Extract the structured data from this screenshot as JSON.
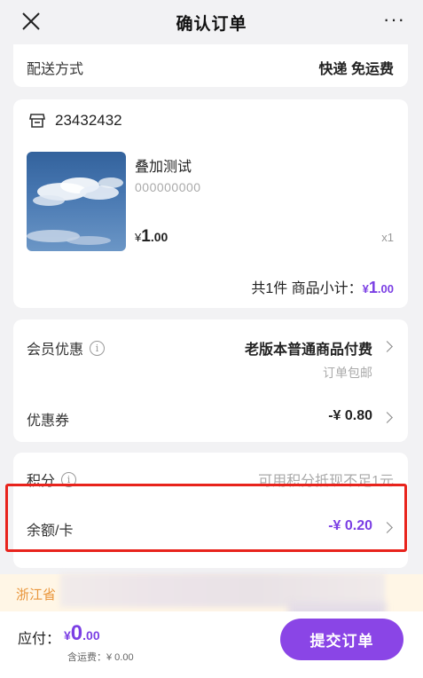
{
  "header": {
    "title": "确认订单",
    "more": "···"
  },
  "delivery": {
    "label": "配送方式",
    "value": "快递 免运费"
  },
  "shop": {
    "name": "23432432"
  },
  "product": {
    "title": "叠加测试",
    "sku": "000000000",
    "price_symbol": "¥",
    "price_int": "1",
    "price_dec": ".00",
    "qty": "x1"
  },
  "subtotal": {
    "prefix": "共1件  商品小计：",
    "symbol": "¥",
    "int": "1",
    "dec": ".00"
  },
  "member": {
    "label": "会员优惠",
    "info": "i",
    "value": "老版本普通商品付费",
    "sub": "订单包邮"
  },
  "coupon": {
    "label": "优惠券",
    "value": "-¥ 0.80"
  },
  "points": {
    "label": "积分",
    "info": "i",
    "value": "可用积分抵现不足1元"
  },
  "balance": {
    "label": "余额/卡",
    "value": "-¥ 0.20"
  },
  "address": {
    "text": "浙江省"
  },
  "footer": {
    "pay_label": "应付：",
    "symbol": "¥",
    "int": "0",
    "dec": ".00",
    "shipping_note": "含运费：¥ 0.00",
    "submit": "提交订单"
  },
  "colors": {
    "accent": "#7b3fe4",
    "button": "#8a45e6",
    "highlight": "#e8231c"
  }
}
